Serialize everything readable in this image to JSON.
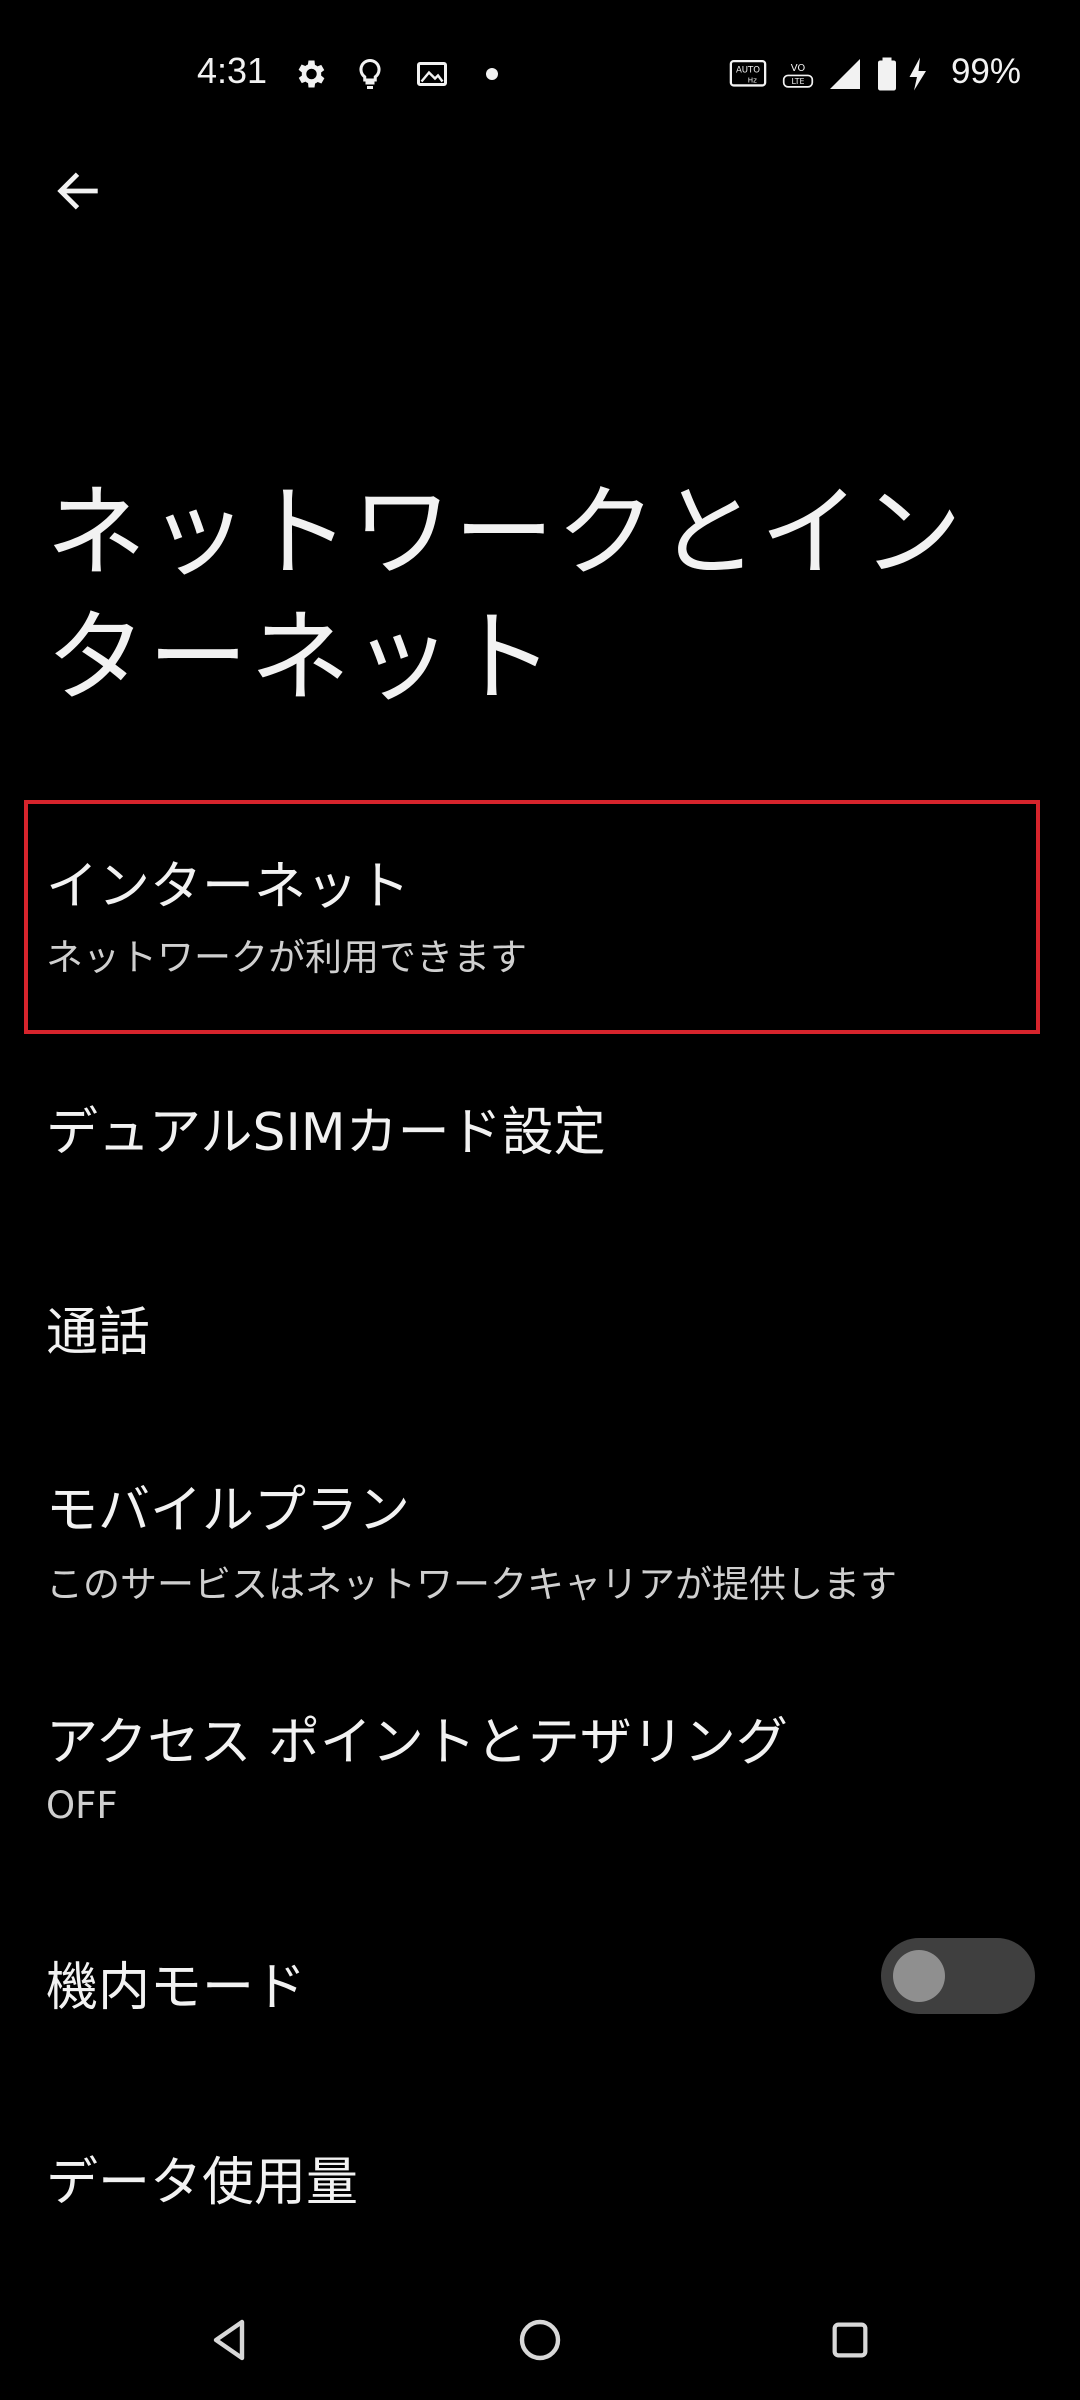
{
  "status_bar": {
    "time": "4:31",
    "battery_percent": "99%",
    "icons": [
      "gear-icon",
      "lightbulb-icon",
      "image-icon",
      "dot-icon",
      "auto-hz-icon",
      "volte-icon",
      "signal-icon",
      "battery-icon",
      "charging-icon"
    ]
  },
  "header": {
    "back_icon": "arrow-left-icon"
  },
  "title": "ネットワークとインターネット",
  "items": [
    {
      "title": "インターネット",
      "summary": "ネットワークが利用できます"
    },
    {
      "title": "デュアルSIMカード設定"
    },
    {
      "title": "通話"
    },
    {
      "title": "モバイルプラン",
      "summary": "このサービスはネットワークキャリアが提供します"
    },
    {
      "title": "アクセス ポイントとテザリング",
      "summary": "OFF"
    },
    {
      "title": "機内モード",
      "toggle_on": false
    },
    {
      "title": "データ使用量"
    }
  ],
  "colors": {
    "highlight": "#d6242c",
    "background": "#000000",
    "text": "#f2f2f2"
  },
  "nav_bar": {
    "icons": [
      "back-triangle-icon",
      "home-circle-icon",
      "recents-square-icon"
    ]
  }
}
